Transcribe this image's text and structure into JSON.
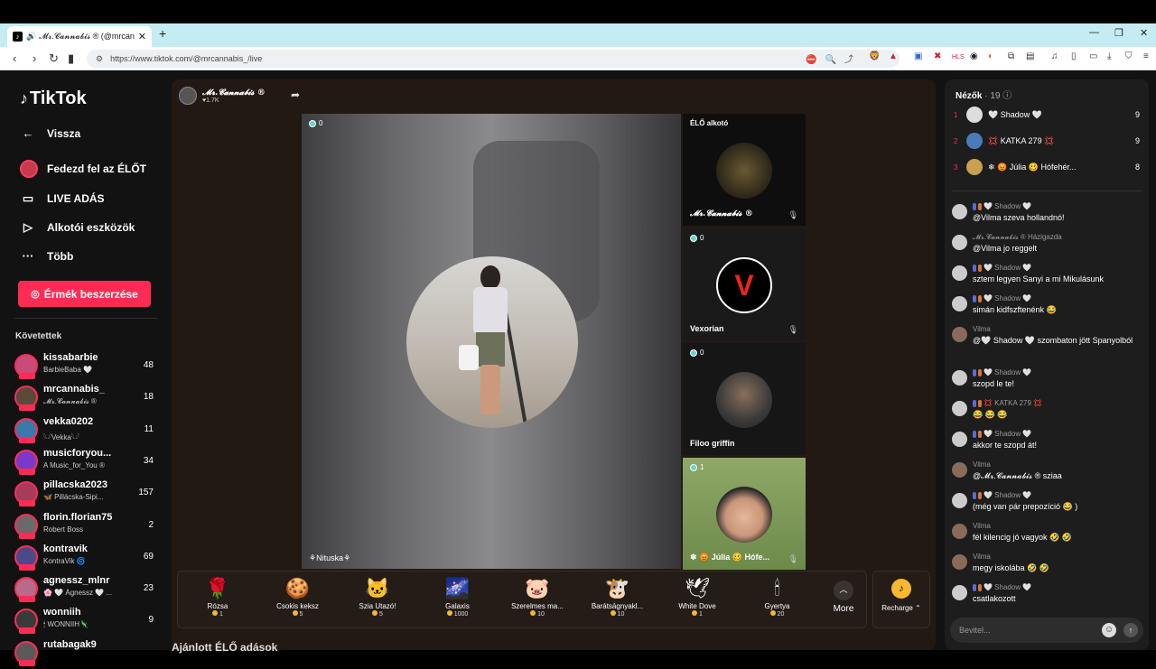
{
  "browser": {
    "tab_title": "𝓜𝓻.𝓒𝓪𝓷𝓷𝓪𝓫𝓲𝓼 ® (@mrcannabis",
    "new_tab": "+",
    "url": "https://www.tiktok.com/@mrcannabis_/live"
  },
  "sidebar": {
    "logo": "TikTok",
    "items": [
      {
        "label": "Vissza",
        "icon": "back-arrow-icon"
      },
      {
        "label": "Fedezd fel az ÉLŐT",
        "icon": "live-avatar-icon"
      },
      {
        "label": "LIVE ADÁS",
        "icon": "video-icon"
      },
      {
        "label": "Alkotói eszközök",
        "icon": "creator-tools-icon"
      },
      {
        "label": "Több",
        "icon": "more-icon"
      }
    ],
    "coins_button": "Érmék beszerzése",
    "following_heading": "Követettek",
    "following": [
      {
        "username": "kissabarbie",
        "nick": "BarbieBaba 🤍",
        "count": "48",
        "color": "#c94b7a"
      },
      {
        "username": "mrcannabis_",
        "nick": "𝓜𝓻.𝓒𝓪𝓷𝓷𝓪𝓫𝓲𝓼 ®",
        "count": "18",
        "color": "#5a4a3a"
      },
      {
        "username": "vekka0202",
        "nick": "𓆩𓆪Vekka𓆩𓆪",
        "count": "11",
        "color": "#3a7aa8"
      },
      {
        "username": "musicforyou...",
        "nick": "A Music_for_You ®",
        "count": "34",
        "color": "#7a3ac9"
      },
      {
        "username": "pillacska2023",
        "nick": "🦋 Pillácska-Sipi...",
        "count": "157",
        "color": "#a83a5a"
      },
      {
        "username": "florin.florian75",
        "nick": "Robert Boss",
        "count": "2",
        "color": "#6a6a6a"
      },
      {
        "username": "kontravik",
        "nick": "KontraVik 🌀",
        "count": "69",
        "color": "#4a4a8a"
      },
      {
        "username": "agnessz_mlnr",
        "nick": "🌸 🤍 Ágnessz 🤍 ...",
        "count": "23",
        "color": "#b86a8a"
      },
      {
        "username": "wonniih",
        "nick": "🕯 WONNIIH🦎",
        "count": "9",
        "color": "#3a3a3a"
      },
      {
        "username": "rutabagak9",
        "nick": "",
        "count": "",
        "color": "#5a5a5a"
      }
    ]
  },
  "stream": {
    "host_name": "𝓜𝓻.𝓒𝓪𝓷𝓷𝓪𝓫𝓲𝓼 ®",
    "host_likes": "♥1.7K",
    "main_count": "0",
    "main_name": "⚘Nituska⚘",
    "guests": [
      {
        "top_label": "ÉLŐ alkotó",
        "name": "𝓜𝓻.𝓒𝓪𝓷𝓷𝓪𝓫𝓲𝓼 ®",
        "count": ""
      },
      {
        "top_label": "",
        "name": "Vexorian",
        "count": "0"
      },
      {
        "top_label": "",
        "name": "Filoo griffin",
        "count": "0"
      },
      {
        "top_label": "",
        "name": "❄ 😡 Júlia 🥴 Hófe...",
        "count": "1"
      }
    ]
  },
  "gifts": [
    {
      "name": "Rózsa",
      "price": "1",
      "icon": "🌹"
    },
    {
      "name": "Csokis keksz",
      "price": "5",
      "icon": "🍪"
    },
    {
      "name": "Szia Utazó!",
      "price": "5",
      "icon": "🐱"
    },
    {
      "name": "Galaxis",
      "price": "1000",
      "icon": "🌌"
    },
    {
      "name": "Szerelmes ma...",
      "price": "10",
      "icon": "🐷"
    },
    {
      "name": "Barátságnyakl...",
      "price": "10",
      "icon": "🐮"
    },
    {
      "name": "White Dove",
      "price": "1",
      "icon": "🕊"
    },
    {
      "name": "Gyertya",
      "price": "20",
      "icon": "🕯"
    }
  ],
  "gift_more": "More",
  "recharge": "Recharge ⌃",
  "recommended_title": "Ajánlott ÉLŐ adások",
  "chat": {
    "viewers_label": "Nézők",
    "viewers_count": "· 19",
    "top_viewers": [
      {
        "rank": "1",
        "name": "🤍 Shadow 🤍",
        "score": "9"
      },
      {
        "rank": "2",
        "name": "💢 KATKA 279 💢",
        "score": "9"
      },
      {
        "rank": "3",
        "name": "❄ 😡 Júlia 🥴 Hófehér...",
        "score": "8"
      }
    ],
    "messages": [
      {
        "name": "🤍 Shadow 🤍",
        "text": "@Vilma szeva hollandnó!",
        "badges": true
      },
      {
        "name": "𝓜𝓻.𝓒𝓪𝓷𝓷𝓪𝓫𝓲𝓼 ® Házigazda",
        "text": "@Vilma jo reggelt",
        "badges": false
      },
      {
        "name": "🤍 Shadow 🤍",
        "text": "sztem legyen Sanyi a mi Mikulásunk",
        "badges": true
      },
      {
        "name": "🤍 Shadow 🤍",
        "text": "simán kidfszftenénk 😂",
        "badges": true
      },
      {
        "name": "Vilma",
        "text": "@🤍 Shadow 🤍 szombaton jött Spanyolból",
        "badges": false
      },
      {
        "name": "🤍 Shadow 🤍",
        "text": "szopd le te!",
        "badges": true
      },
      {
        "name": "💢 KATKA 279 💢",
        "text": "😂 😂 😂",
        "badges": true
      },
      {
        "name": "🤍 Shadow 🤍",
        "text": "akkor te szopd át!",
        "badges": true
      },
      {
        "name": "Vilma",
        "text": "@𝓜𝓻.𝓒𝓪𝓷𝓷𝓪𝓫𝓲𝓼 ® sziaa",
        "badges": false
      },
      {
        "name": "🤍 Shadow 🤍",
        "text": "(még van pár prepozíció 😂 )",
        "badges": true
      },
      {
        "name": "Vilma",
        "text": "fél kilencig jó vagyok 🤣 🤣",
        "badges": false
      },
      {
        "name": "Vilma",
        "text": "megy iskolába 🤣 🤣",
        "badges": false
      },
      {
        "name": "🤍 Shadow 🤍",
        "text": "csatlakozott",
        "badges": true
      }
    ],
    "input_placeholder": "Bevitel..."
  }
}
